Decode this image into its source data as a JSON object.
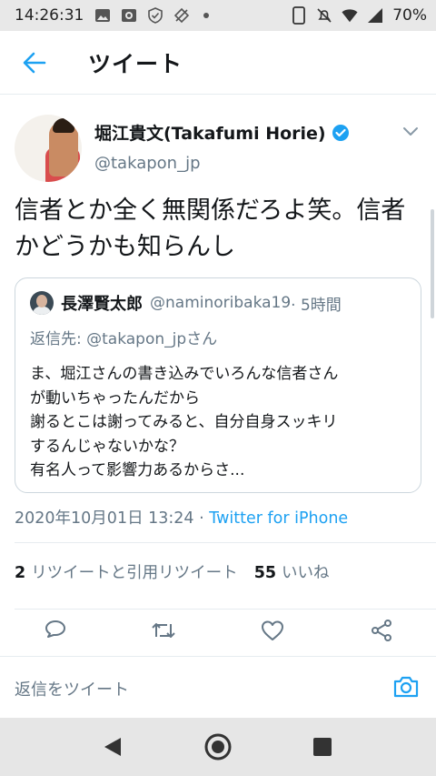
{
  "status_bar": {
    "time": "14:26:31",
    "battery": "70%",
    "icons_left": [
      "image-icon",
      "camera-app-icon",
      "shield-check-icon",
      "no-signal-location-icon",
      "notification-dot-icon"
    ],
    "icons_right": [
      "phone-icon",
      "mute-icon",
      "wifi-icon",
      "cell-signal-icon"
    ]
  },
  "header": {
    "title": "ツイート"
  },
  "tweet": {
    "display_name": "堀江貴文(Takafumi Horie)",
    "handle": "@takapon_jp",
    "text": "信者とか全く無関係だろよ笑。信者かどうかも知らんし",
    "timestamp": "2020年10月01日 13:24",
    "separator": " · ",
    "source": "Twitter for iPhone",
    "retweets_count": "2",
    "retweets_label": "リツイートと引用リツイート",
    "likes_count": "55",
    "likes_label": "いいね"
  },
  "quote": {
    "display_name": "長澤賢太郎",
    "handle": "@naminoribaka19",
    "time": " · 5時間",
    "reply_to": "返信先: @takapon_jpさん",
    "lines": [
      "ま、堀江さんの書き込みでいろんな信者さん",
      "が動いちゃったんだから",
      "謝るとこは謝ってみると、自分自身スッキリ",
      "するんじゃないかな？",
      "有名人って影響力あるからさ..."
    ]
  },
  "reply_bar": {
    "placeholder": "返信をツイート"
  },
  "colors": {
    "accent": "#1da1f2",
    "secondary_text": "#657786",
    "border": "#e6ecf0"
  }
}
